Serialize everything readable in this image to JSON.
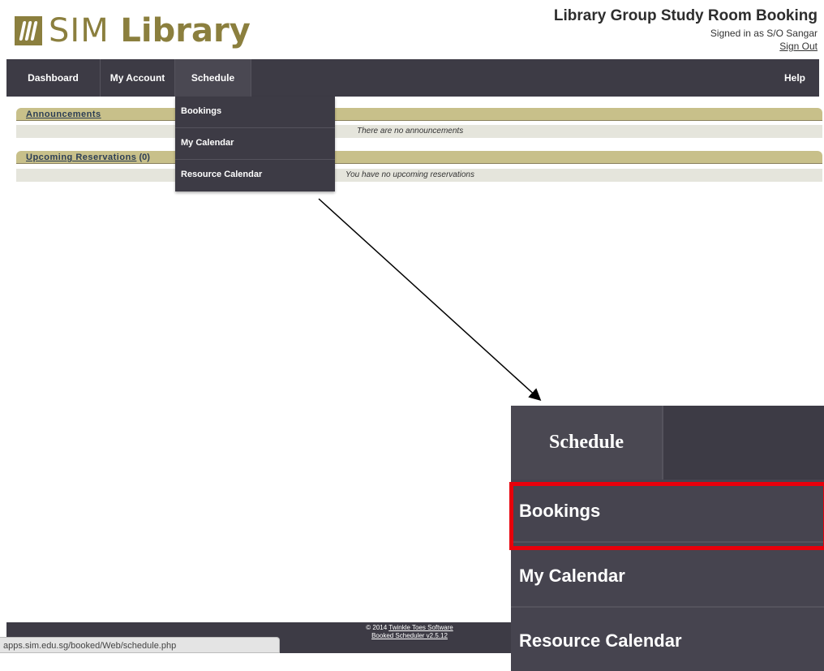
{
  "header": {
    "logo_sim": "SIM",
    "logo_library": "Library",
    "app_title": "Library Group Study Room Booking",
    "signed_in": "Signed in as S/O Sangar",
    "sign_out": "Sign Out"
  },
  "nav": {
    "dashboard": "Dashboard",
    "my_account": "My Account",
    "schedule": "Schedule",
    "help": "Help"
  },
  "dropdown": {
    "items": [
      "Bookings",
      "My Calendar",
      "Resource Calendar"
    ]
  },
  "announcements": {
    "title": "Announcements",
    "empty": "There are no announcements"
  },
  "upcoming": {
    "title": "Upcoming Reservations",
    "count": "(0)",
    "empty": "You have no upcoming reservations"
  },
  "footer": {
    "copyright": "© 2014",
    "company": "Twinkle Toes Software",
    "version": "Booked Scheduler v2.5.12"
  },
  "statusbar": {
    "url": "apps.sim.edu.sg/booked/Web/schedule.php"
  },
  "zoom": {
    "tab": "Schedule",
    "items": [
      "Bookings",
      "My Calendar",
      "Resource Calendar"
    ]
  },
  "colors": {
    "nav_bg": "#3d3b45",
    "brand": "#8b7f3e",
    "section_header": "#c8c08a",
    "highlight": "#e8000b"
  }
}
